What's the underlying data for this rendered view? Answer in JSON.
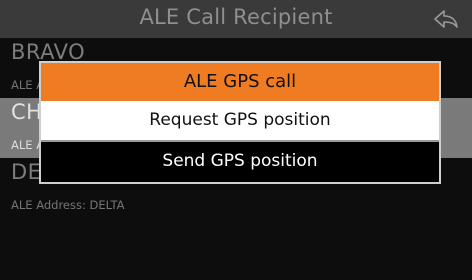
{
  "screen": {
    "title": "ALE Call Recipient",
    "back_icon": "back-arrow-icon"
  },
  "recipients": [
    {
      "name": "BRAVO",
      "address": "ALE Address: BRAVO",
      "selected": false
    },
    {
      "name": "CHARLIE",
      "address": "ALE Address: CHARLIE",
      "selected": true
    },
    {
      "name": "DELTA",
      "address": "ALE Address: DELTA",
      "selected": false
    }
  ],
  "dialog": {
    "title": "ALE GPS call",
    "options": [
      {
        "label": "Request GPS position"
      },
      {
        "label": "Send GPS position"
      }
    ]
  },
  "colors": {
    "accent": "#ef7b22",
    "selected_row": "#7a7a7a",
    "titlebar": "#3a3a3a"
  }
}
